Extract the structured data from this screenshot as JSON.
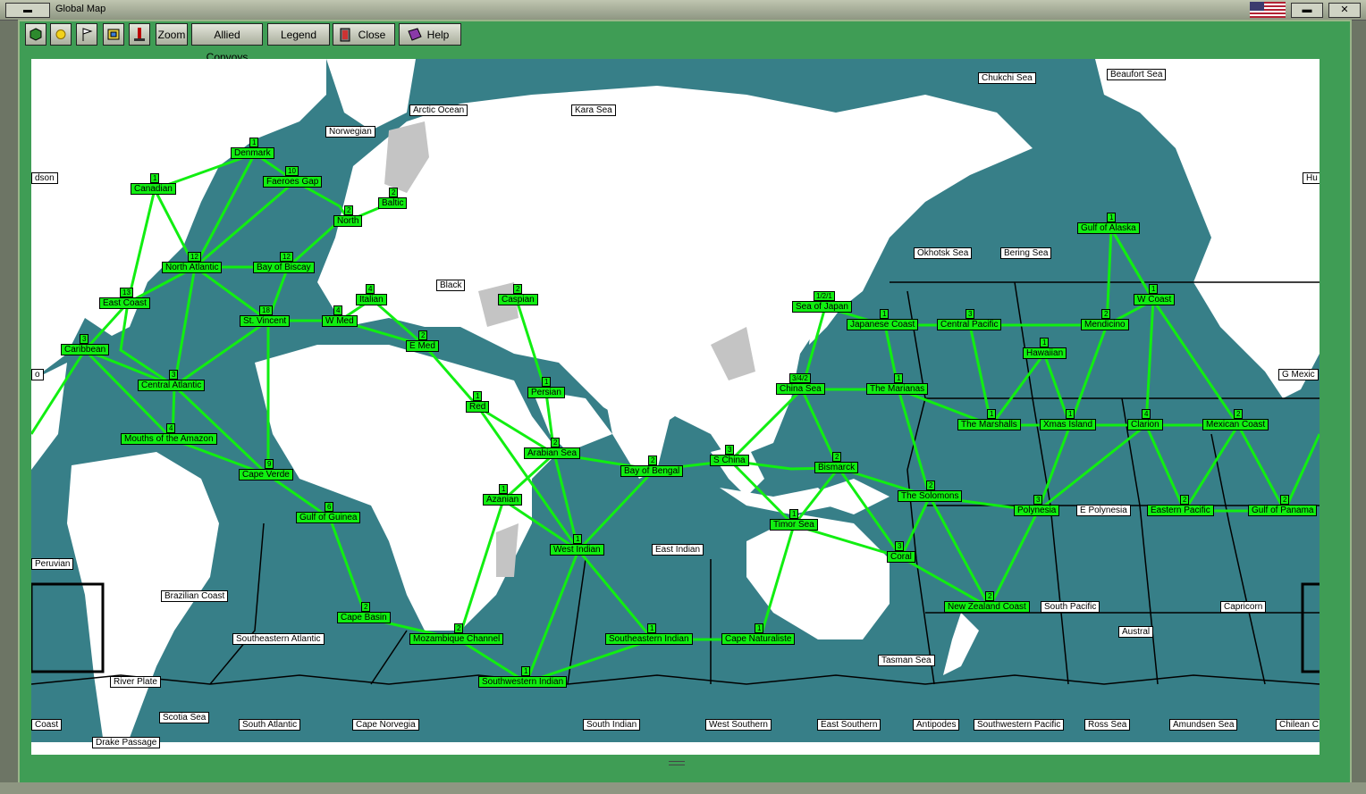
{
  "window": {
    "title": "Global Map",
    "sys_label": "▬",
    "min_label": "▬",
    "close_label": "✕"
  },
  "toolbar": {
    "icons": [
      "hexagon-icon",
      "sun-icon",
      "flag-icon",
      "grid-icon",
      "ship-icon"
    ],
    "buttons": [
      {
        "id": "zoom",
        "label": "Zoom"
      },
      {
        "id": "convoys",
        "label": "Allied Convoys"
      },
      {
        "id": "legend",
        "label": "Legend"
      },
      {
        "id": "close",
        "label": "Close"
      },
      {
        "id": "help",
        "label": "Help"
      }
    ]
  },
  "colors": {
    "ocean": "#377f88",
    "land": "#ffffff",
    "route": "#11ee11",
    "zone_label": "#11ee11",
    "frame": "#3f9d55"
  },
  "sea_labels": [
    "Arctic Ocean",
    "Kara Sea",
    "Chukchi Sea",
    "Beaufort Sea",
    "Norwegian",
    "dson",
    "Black",
    "Okhotsk Sea",
    "Bering Sea",
    "Hu",
    "G Mexic",
    "o",
    "Peruvian",
    "Brazilian Coast",
    "Southeastern Atlantic",
    "River Plate",
    "Scotia Sea",
    "Drake Passage",
    "South Atlantic",
    "Cape Norvegia",
    "South Indian",
    "West Southern",
    "East Southern",
    "Antipodes",
    "Southwestern Pacific",
    "Ross Sea",
    "Amundsen Sea",
    "Chilean C",
    "East Indian",
    "Tasman Sea",
    "South Pacific",
    "Austral",
    "Capricorn",
    "E Polynesia",
    "Coast"
  ],
  "zones": [
    {
      "name": "Denmark",
      "count": "1"
    },
    {
      "name": "Canadian",
      "count": "1"
    },
    {
      "name": "Faeroes Gap",
      "count": "10"
    },
    {
      "name": "Baltic",
      "count": "2"
    },
    {
      "name": "North",
      "count": "2"
    },
    {
      "name": "North Atlantic",
      "count": "12"
    },
    {
      "name": "Bay of Biscay",
      "count": "12"
    },
    {
      "name": "East Coast",
      "count": "13"
    },
    {
      "name": "Italian",
      "count": "4"
    },
    {
      "name": "Caspian",
      "count": "2"
    },
    {
      "name": "St. Vincent",
      "count": "18"
    },
    {
      "name": "W Med",
      "count": "4"
    },
    {
      "name": "E Med",
      "count": "2"
    },
    {
      "name": "Caribbean",
      "count": "3"
    },
    {
      "name": "Central Atlantic",
      "count": "3"
    },
    {
      "name": "Persian",
      "count": "1"
    },
    {
      "name": "Red",
      "count": "1"
    },
    {
      "name": "Mouths of the Amazon",
      "count": "4"
    },
    {
      "name": "Cape Verde",
      "count": "9"
    },
    {
      "name": "Arabian Sea",
      "count": "2"
    },
    {
      "name": "Bay of Bengal",
      "count": "2"
    },
    {
      "name": "Azanian",
      "count": "1"
    },
    {
      "name": "Gulf of Guinea",
      "count": "6"
    },
    {
      "name": "West Indian",
      "count": "1"
    },
    {
      "name": "Cape Basin",
      "count": "2"
    },
    {
      "name": "Mozambique Channel",
      "count": "2"
    },
    {
      "name": "Southeastern Indian",
      "count": "1"
    },
    {
      "name": "Cape Naturaliste",
      "count": "1"
    },
    {
      "name": "Southwestern Indian",
      "count": "1"
    },
    {
      "name": "S China",
      "count": "3"
    },
    {
      "name": "Timor Sea",
      "count": "1"
    },
    {
      "name": "Bismarck",
      "count": "2"
    },
    {
      "name": "China Sea",
      "count": "3/4/2"
    },
    {
      "name": "Sea of Japan",
      "count": "1/2/1"
    },
    {
      "name": "Japanese Coast",
      "count": "1"
    },
    {
      "name": "The Marianas",
      "count": "1"
    },
    {
      "name": "Central Pacific",
      "count": "3"
    },
    {
      "name": "The Solomons",
      "count": "2"
    },
    {
      "name": "Coral",
      "count": "3"
    },
    {
      "name": "New Zealand Coast",
      "count": "2"
    },
    {
      "name": "The Marshalls",
      "count": "1"
    },
    {
      "name": "Hawaiian",
      "count": "1"
    },
    {
      "name": "Xmas Island",
      "count": "1"
    },
    {
      "name": "Polynesia",
      "count": "3"
    },
    {
      "name": "Gulf of Alaska",
      "count": "1"
    },
    {
      "name": "Mendicino",
      "count": "2"
    },
    {
      "name": "W Coast",
      "count": "1"
    },
    {
      "name": "Clarion",
      "count": "4"
    },
    {
      "name": "Mexican Coast",
      "count": "2"
    },
    {
      "name": "Eastern Pacific",
      "count": "2"
    },
    {
      "name": "Gulf of Panama",
      "count": "2"
    }
  ]
}
